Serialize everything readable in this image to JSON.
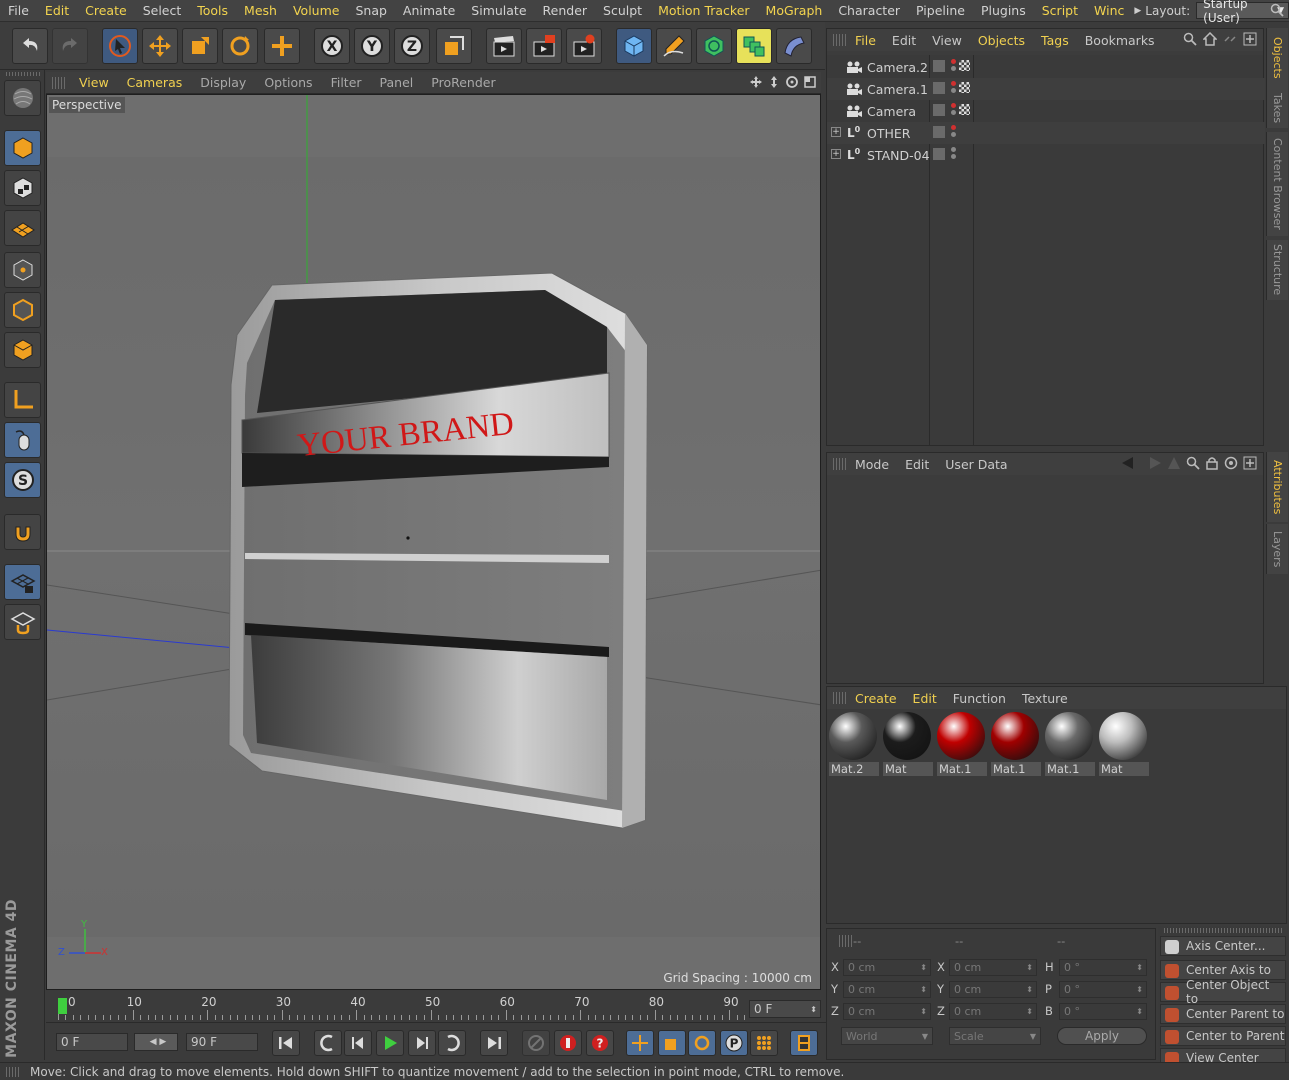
{
  "menu": {
    "items": [
      {
        "label": "File",
        "hl": false
      },
      {
        "label": "Edit",
        "hl": true
      },
      {
        "label": "Create",
        "hl": true
      },
      {
        "label": "Select",
        "hl": false
      },
      {
        "label": "Tools",
        "hl": true
      },
      {
        "label": "Mesh",
        "hl": true
      },
      {
        "label": "Volume",
        "hl": true
      },
      {
        "label": "Snap",
        "hl": false
      },
      {
        "label": "Animate",
        "hl": false
      },
      {
        "label": "Simulate",
        "hl": false
      },
      {
        "label": "Render",
        "hl": false
      },
      {
        "label": "Sculpt",
        "hl": false
      },
      {
        "label": "Motion Tracker",
        "hl": true
      },
      {
        "label": "MoGraph",
        "hl": true
      },
      {
        "label": "Character",
        "hl": false
      },
      {
        "label": "Pipeline",
        "hl": false
      },
      {
        "label": "Plugins",
        "hl": false
      },
      {
        "label": "Script",
        "hl": true
      },
      {
        "label": "Winc",
        "hl": true
      }
    ],
    "layout_label": "Layout:",
    "layout_value": "Startup (User)"
  },
  "viewport": {
    "menu": [
      {
        "label": "View",
        "hl": true
      },
      {
        "label": "Cameras",
        "hl": true
      },
      {
        "label": "Display",
        "hl": false
      },
      {
        "label": "Options",
        "hl": false
      },
      {
        "label": "Filter",
        "hl": false
      },
      {
        "label": "Panel",
        "hl": false
      },
      {
        "label": "ProRender",
        "hl": false
      }
    ],
    "camera_label": "Perspective",
    "grid_spacing": "Grid Spacing : 10000 cm",
    "brand_text": "YOUR BRAND",
    "axis_x": "X",
    "axis_y": "Y",
    "axis_z": "Z"
  },
  "timeline": {
    "ticks": [
      "0",
      "10",
      "20",
      "30",
      "40",
      "50",
      "60",
      "70",
      "80",
      "90"
    ],
    "current_frame": "0 F",
    "start_frame": "0 F",
    "end_frame": "90 F"
  },
  "status": "Move: Click and drag to move elements. Hold down SHIFT to quantize movement / add to the selection in point mode, CTRL to remove.",
  "objects_panel": {
    "menu": [
      {
        "label": "File",
        "hl": true
      },
      {
        "label": "Edit",
        "hl": false
      },
      {
        "label": "View",
        "hl": false
      },
      {
        "label": "Objects",
        "hl": true
      },
      {
        "label": "Tags",
        "hl": true
      },
      {
        "label": "Bookmarks",
        "hl": false
      }
    ],
    "rows": [
      {
        "name": "Camera.2",
        "type": "camera"
      },
      {
        "name": "Camera.1",
        "type": "camera"
      },
      {
        "name": "Camera",
        "type": "camera"
      },
      {
        "name": "OTHER",
        "type": "null"
      },
      {
        "name": "STAND-04",
        "type": "null"
      }
    ]
  },
  "side_tabs_top": [
    "Objects",
    "Takes",
    "Content Browser",
    "Structure"
  ],
  "side_tabs_attr": [
    "Attributes",
    "Layers"
  ],
  "attributes_panel": {
    "menu": [
      "Mode",
      "Edit",
      "User Data"
    ]
  },
  "materials_panel": {
    "menu": [
      {
        "label": "Create",
        "hl": true
      },
      {
        "label": "Edit",
        "hl": true
      },
      {
        "label": "Function",
        "hl": false
      },
      {
        "label": "Texture",
        "hl": false
      }
    ],
    "materials": [
      {
        "name": "Mat.2",
        "color": "#5a5a5a"
      },
      {
        "name": "Mat",
        "color": "#1c1c1c"
      },
      {
        "name": "Mat.1",
        "color": "#c00000"
      },
      {
        "name": "Mat.1",
        "color": "#a00000"
      },
      {
        "name": "Mat.1",
        "color": "#6a6a6a"
      },
      {
        "name": "Mat",
        "color": "#bdbdbd"
      }
    ]
  },
  "coords_panel": {
    "headers": [
      "--",
      "--",
      "--"
    ],
    "rows": [
      {
        "a": "X",
        "av": "0 cm",
        "b": "X",
        "bv": "0 cm",
        "c": "H",
        "cv": "0 °"
      },
      {
        "a": "Y",
        "av": "0 cm",
        "b": "Y",
        "bv": "0 cm",
        "c": "P",
        "cv": "0 °"
      },
      {
        "a": "Z",
        "av": "0 cm",
        "b": "Z",
        "bv": "0 cm",
        "c": "B",
        "cv": "0 °"
      }
    ],
    "world": "World",
    "scale": "Scale",
    "apply": "Apply"
  },
  "axis_commands": [
    "Axis Center...",
    "Center Axis to",
    "Center Object to",
    "Center Parent to",
    "Center to Parent",
    "View Center"
  ],
  "brand_logo": "MAXON CINEMA 4D"
}
